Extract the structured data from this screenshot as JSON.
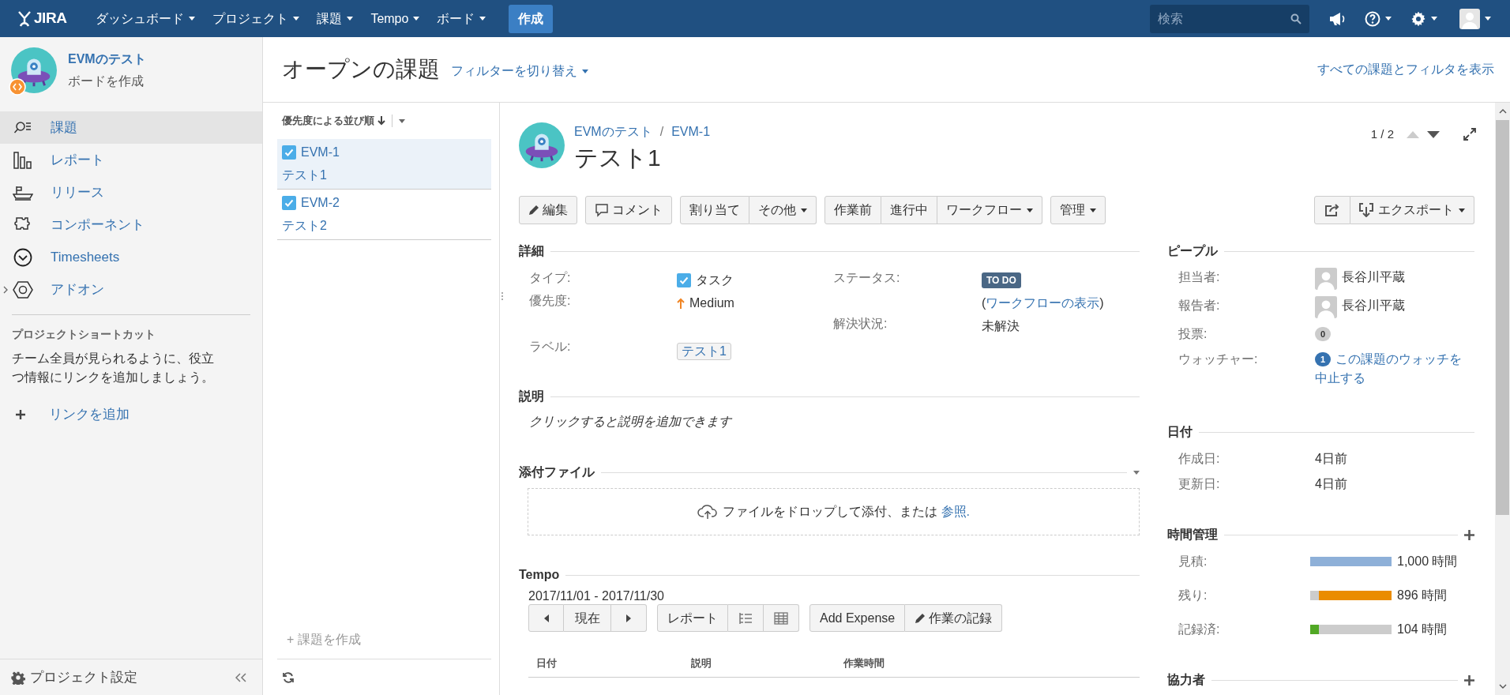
{
  "top_nav": {
    "logo": "JIRA",
    "items": [
      {
        "label": "ダッシュボード",
        "dropdown": true
      },
      {
        "label": "プロジェクト",
        "dropdown": true
      },
      {
        "label": "課題",
        "dropdown": true
      },
      {
        "label": "Tempo",
        "dropdown": true
      },
      {
        "label": "ボード",
        "dropdown": true
      }
    ],
    "create": "作成",
    "search": {
      "placeholder": "検索"
    }
  },
  "sidebar": {
    "project_name": "EVMのテスト",
    "project_subtitle": "ボードを作成",
    "items": [
      {
        "label": "課題",
        "selected": true,
        "expandable": false
      },
      {
        "label": "レポート",
        "selected": false,
        "expandable": false
      },
      {
        "label": "リリース",
        "selected": false,
        "expandable": false
      },
      {
        "label": "コンポーネント",
        "selected": false,
        "expandable": false
      },
      {
        "label": "Timesheets",
        "selected": false,
        "expandable": false
      },
      {
        "label": "アドオン",
        "selected": false,
        "expandable": true
      }
    ],
    "shortcuts_heading": "プロジェクトショートカット",
    "shortcuts_text": "チーム全員が見られるように、役立つ情報にリンクを追加しましょう。",
    "add_link": "リンクを追加",
    "settings": "プロジェクト設定"
  },
  "header": {
    "title": "オープンの課題",
    "filter_switch": "フィルターを切り替え",
    "all_link": "すべての課題とフィルタを表示"
  },
  "issue_list": {
    "sort": "優先度による並び順",
    "issues": [
      {
        "key": "EVM-1",
        "summary": "テスト1",
        "selected": true
      },
      {
        "key": "EVM-2",
        "summary": "テスト2",
        "selected": false
      }
    ],
    "create": "+ 課題を作成"
  },
  "issue": {
    "project": "EVMのテスト",
    "separator": "/",
    "key": "EVM-1",
    "title": "テスト1",
    "pager": {
      "text": "1 / 2",
      "prev_disabled": true,
      "next_disabled": false
    },
    "toolbar": [
      [
        {
          "label": "編集",
          "dropdown": false
        }
      ],
      [
        {
          "label": "コメント",
          "dropdown": false
        }
      ],
      [
        {
          "label": "割り当て",
          "dropdown": false
        },
        {
          "label": "その他",
          "dropdown": true
        }
      ],
      [
        {
          "label": "作業前",
          "dropdown": false
        },
        {
          "label": "進行中",
          "dropdown": false
        },
        {
          "label": "ワークフロー",
          "dropdown": true
        }
      ],
      [
        {
          "label": "管理",
          "dropdown": true
        }
      ]
    ],
    "export": {
      "label": "エクスポート",
      "dropdown": true
    },
    "details": {
      "heading": "詳細",
      "rows": [
        {
          "left": {
            "label": "タイプ:",
            "value": "タスク",
            "kind": "type"
          },
          "right": {
            "label": "ステータス:",
            "value": "TO DO",
            "kind": "status"
          }
        },
        {
          "left": {
            "label": "優先度:",
            "value": "Medium",
            "kind": "priority"
          },
          "right": {
            "prefix": "(",
            "value": "ワークフローの表示",
            "suffix": ")",
            "kind": "link"
          }
        },
        {
          "right": {
            "label": "解決状況:",
            "value": "未解決",
            "kind": "text"
          }
        },
        {
          "left": {
            "label": "ラベル:",
            "value": "テスト1",
            "kind": "label"
          }
        }
      ]
    },
    "description": {
      "heading": "説明",
      "placeholder": "クリックすると説明を追加できます"
    },
    "attachments": {
      "heading": "添付ファイル",
      "drop_text": "ファイルをドロップして添付、または",
      "browse": "参照."
    },
    "tempo": {
      "heading": "Tempo",
      "period": "2017/11/01 - 2017/11/30",
      "current": "現在",
      "report": "レポート",
      "add_expense": "Add Expense",
      "log_work": "作業の記録",
      "columns": [
        "日付",
        "説明",
        "作業時間"
      ]
    },
    "people": {
      "heading": "ピープル",
      "rows": [
        {
          "label": "担当者:",
          "value": "長谷川平蔵",
          "kind": "user"
        },
        {
          "label": "報告者:",
          "value": "長谷川平蔵",
          "kind": "user"
        },
        {
          "label": "投票:",
          "count": "0",
          "kind": "votes"
        },
        {
          "label": "ウォッチャー:",
          "count": "1",
          "value": "この課題のウォッチを中止する",
          "kind": "watchers"
        }
      ]
    },
    "dates": {
      "heading": "日付",
      "rows": [
        {
          "label": "作成日:",
          "value": "4日前"
        },
        {
          "label": "更新日:",
          "value": "4日前"
        }
      ]
    },
    "time_tracking": {
      "heading": "時間管理",
      "rows": [
        {
          "label": "見積:",
          "value": "1,000 時間",
          "level": 1,
          "color": "#8eb0d8",
          "kind": "left"
        },
        {
          "label": "残り:",
          "value": "896 時間",
          "level": 0.896,
          "color": "#ea8c00",
          "kind": "right"
        },
        {
          "label": "記録済:",
          "value": "104 時間",
          "level": 0.104,
          "color": "#51a825",
          "kind": "left"
        }
      ]
    },
    "collaborators": {
      "heading": "協力者"
    }
  }
}
